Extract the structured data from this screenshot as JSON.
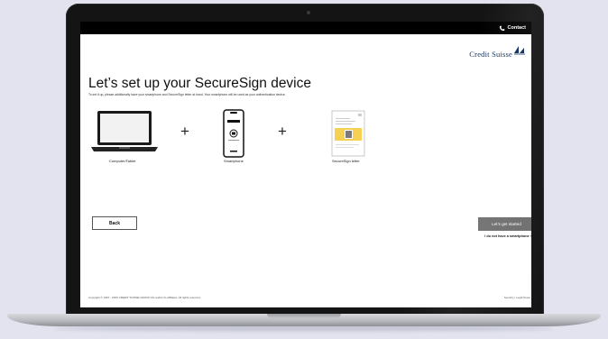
{
  "header": {
    "contact_label": "Contact",
    "logo_text": "Credit Suisse"
  },
  "main": {
    "title": "Let’s set up your SecureSign device",
    "subtitle": "To set it up, please additionally have your smartphone and SecureSign letter at hand. Your smartphone will be used as your authentication device.",
    "devices": [
      {
        "label": "Computer/Tablet",
        "icon": "laptop-icon"
      },
      {
        "label": "Smartphone",
        "icon": "smartphone-icon"
      },
      {
        "label": "SecureSign letter",
        "icon": "letter-icon"
      }
    ],
    "plus_symbol": "+"
  },
  "actions": {
    "back_label": "Back",
    "start_label": "Let’s get started",
    "no_smartphone_label": "I do not have a smartphone",
    "no_smartphone_arrow": "›"
  },
  "footer": {
    "copyright": "Copyright © 1997 - 2020 CREDIT SUISSE GROUP AG and/or its affiliates. All rights reserved.",
    "links": "Security | Legal Notes"
  },
  "colors": {
    "background": "#e2e3ef",
    "topbar": "#000000",
    "brand_navy": "#0b2a5a",
    "primary_button": "#6e6e6e",
    "letter_highlight": "#f3c834"
  }
}
